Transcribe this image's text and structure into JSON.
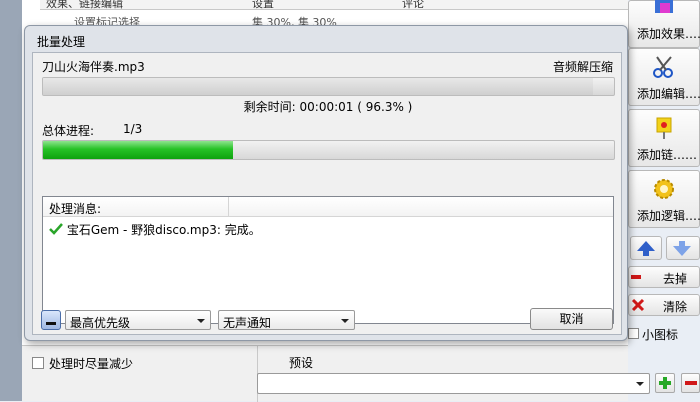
{
  "background": {
    "list_headers": [
      "效果、链接编辑",
      "设置",
      "评论"
    ],
    "list_row": [
      "设置标记选择",
      "集 30%, 集 30%"
    ],
    "minimize_checkbox_label": "处理时尽量减少",
    "preset_label": "预设",
    "preset_value": "",
    "small_icons_label": "小图标"
  },
  "right_toolbar": {
    "add_effect": "添加效果……",
    "add_editor": "添加编辑……",
    "add_link": "添加链……",
    "add_logic": "添加逻辑……",
    "remove": "去掉",
    "clear": "清除"
  },
  "dialog": {
    "title": "批量处理",
    "file_name": "刀山火海伴奏.mp3",
    "operation": "音频解压缩",
    "file_progress": 0.963,
    "time_remaining_label": "剩余时间:",
    "time_remaining": "00:00:01",
    "percent_text": "( 96.3% )",
    "total_label": "总体进程:",
    "total_count": "1/3",
    "total_progress": 0.333,
    "messages_header": "处理消息:",
    "messages": [
      "宝石Gem - 野狼disco.mp3: 完成。"
    ],
    "priority": "最高优先级",
    "notify": "无声通知",
    "cancel": "取消"
  },
  "colors": {
    "progress_green": "#17b117",
    "check_green": "#2aa52a",
    "accent_blue": "#2f5fc9",
    "clear_red": "#d01818"
  }
}
